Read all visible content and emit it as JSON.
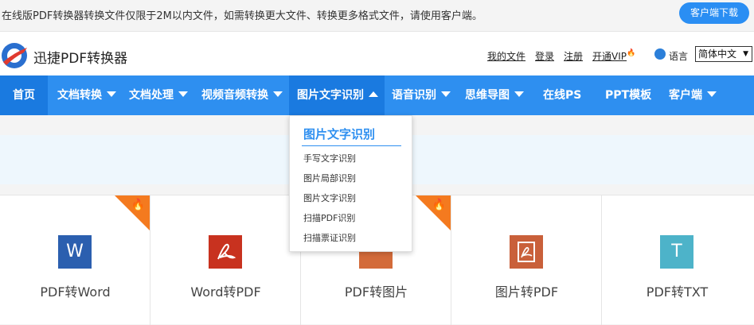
{
  "topbar": {
    "notice": "在线版PDF转换器转换文件仅限于2M以内文件，如需转换更大文件、转换更多格式文件，请使用客户端。",
    "download_button": "客户端下载"
  },
  "header": {
    "brand": "迅捷PDF转换器",
    "links": [
      "我的文件",
      "登录",
      "注册",
      "开通VIP"
    ],
    "lang_label": "语言",
    "lang_value": "简体中文"
  },
  "nav": {
    "items": [
      "首页",
      "文档转换",
      "文档处理",
      "视频音频转换",
      "图片文字识别",
      "语音识别",
      "思维导图",
      "在线PS",
      "PPT模板",
      "客户端"
    ]
  },
  "dropdown": {
    "title": "图片文字识别",
    "items": [
      "手写文字识别",
      "图片局部识别",
      "图片文字识别",
      "扫描PDF识别",
      "扫描票证识别"
    ]
  },
  "tools": {
    "items": [
      {
        "label": "PDF转Word",
        "icon": "W",
        "color": "#2b5faf"
      },
      {
        "label": "Word转PDF",
        "icon": "pdf-icon",
        "color": "#c8321f"
      },
      {
        "label": "PDF转图片",
        "icon": "image-icon",
        "color": "#d36b3a"
      },
      {
        "label": "图片转PDF",
        "icon": "pdf-icon",
        "color": "#c9603a"
      },
      {
        "label": "PDF转TXT",
        "icon": "T",
        "color": "#4db3c9"
      }
    ]
  }
}
